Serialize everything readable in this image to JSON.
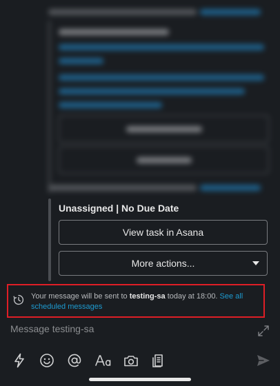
{
  "card": {
    "heading": "Unassigned | No Due Date",
    "view_button": "View task in Asana",
    "more_button": "More actions..."
  },
  "notice": {
    "prefix": "Your message will be sent to ",
    "channel": "testing-sa",
    "suffix": " today at 18:00. ",
    "link": "See all scheduled messages"
  },
  "composer": {
    "placeholder": "Message testing-sa"
  },
  "toolbar": {
    "icons": [
      "lightning-icon",
      "emoji-icon",
      "mention-icon",
      "text-format-icon",
      "camera-icon",
      "attachment-icon",
      "send-icon"
    ]
  },
  "colors": {
    "background": "#1a1d21",
    "link": "#1d9bd1",
    "highlight_border": "#e01e26"
  }
}
